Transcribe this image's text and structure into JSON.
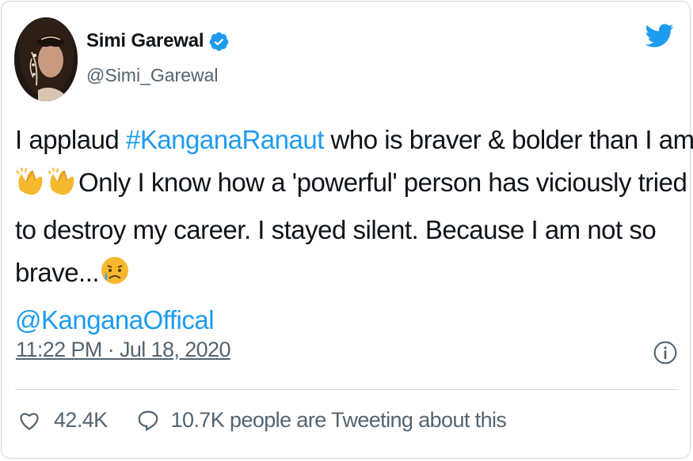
{
  "user": {
    "display_name": "Simi Garewal",
    "handle": "@Simi_Garewal",
    "verified": true
  },
  "tweet": {
    "line1_pre": "I applaud ",
    "line1_hashtag": "#KanganaRanaut",
    "line1_post": " who is braver & bolder than I am.",
    "line2": "Only I know how a 'powerful' person has viciously tried",
    "line3": "to destroy my career. I stayed silent. Because I am not so",
    "line4": "brave...",
    "mention": "@KanganaOffical",
    "emojis": [
      "clapping-hands",
      "clapping-hands",
      "sad-but-relieved-face"
    ]
  },
  "timestamp": "11:22 PM · Jul 18, 2020",
  "engagement": {
    "likes": "42.4K",
    "tweeting": "10.7K people are Tweeting about this"
  },
  "colors": {
    "brand_blue": "#1d9bf0",
    "text_primary": "#0f1419",
    "text_secondary": "#536471",
    "border": "#cfd9de"
  },
  "icons": [
    "verified-badge-icon",
    "twitter-bird-icon",
    "info-icon",
    "heart-icon",
    "reply-icon"
  ]
}
